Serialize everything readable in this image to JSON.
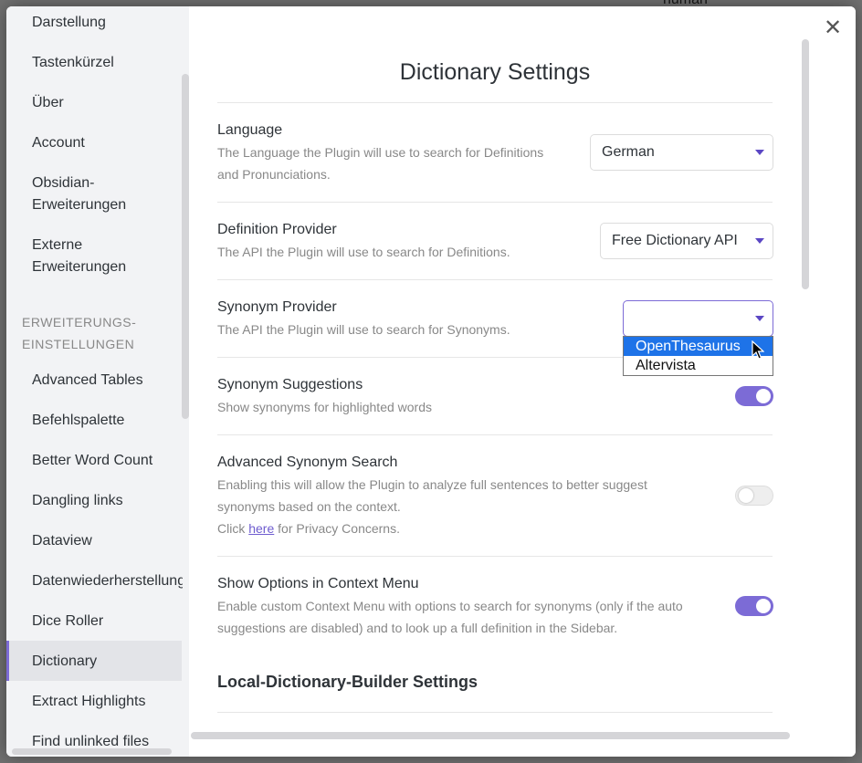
{
  "sidebar": {
    "items_top": [
      {
        "label": "Darstellung"
      },
      {
        "label": "Tastenkürzel"
      },
      {
        "label": "Über"
      },
      {
        "label": "Account"
      },
      {
        "label": "Obsidian-"
      },
      {
        "label": "Erweiterungen"
      },
      {
        "label": "Externe"
      },
      {
        "label": "Erweiterungen"
      }
    ],
    "section_heading_line1": "ERWEITERUNGS-",
    "section_heading_line2": "EINSTELLUNGEN",
    "plugins": [
      {
        "label": "Advanced Tables"
      },
      {
        "label": "Befehlspalette"
      },
      {
        "label": "Better Word Count"
      },
      {
        "label": "Dangling links"
      },
      {
        "label": "Dataview"
      },
      {
        "label": "Datenwiederherstellung"
      },
      {
        "label": "Dice Roller"
      },
      {
        "label": "Dictionary"
      },
      {
        "label": "Extract Highlights"
      },
      {
        "label": "Find unlinked files"
      }
    ],
    "active_item": "Dictionary",
    "accent_color": "#7c6bd6"
  },
  "modal": {
    "close_icon": "close-icon",
    "title": "Dictionary Settings"
  },
  "settings": {
    "language": {
      "name": "Language",
      "desc_line1": "The Language the Plugin will use to search for Definitions",
      "desc_line2": "and Pronunciations.",
      "value": "German"
    },
    "definition_provider": {
      "name": "Definition Provider",
      "desc": "The API the Plugin will use to search for Definitions.",
      "value": "Free Dictionary API"
    },
    "synonym_provider": {
      "name": "Synonym Provider",
      "desc": "The API the Plugin will use to search for Synonyms.",
      "value": "",
      "options": [
        "OpenThesaurus",
        "Altervista"
      ],
      "highlighted_option": "OpenThesaurus"
    },
    "synonym_suggestions": {
      "name": "Synonym Suggestions",
      "desc": "Show synonyms for highlighted words",
      "enabled": true
    },
    "advanced_synonym_search": {
      "name": "Advanced Synonym Search",
      "desc_line1": "Enabling this will allow the Plugin to analyze full sentences to better suggest",
      "desc_line2": "synonyms based on the context.",
      "desc_click": "Click",
      "desc_link": "here",
      "desc_after_link": "for Privacy Concerns.",
      "enabled": false
    },
    "context_menu": {
      "name": "Show Options in Context Menu",
      "desc_line1": "Enable custom Context Menu with options to search for synonyms (only if the auto",
      "desc_line2": "suggestions are disabled) and to look up a full definition in the Sidebar.",
      "enabled": true
    }
  },
  "local_builder": {
    "heading": "Local-Dictionary-Builder Settings"
  },
  "background": {
    "fragment": "numan"
  }
}
